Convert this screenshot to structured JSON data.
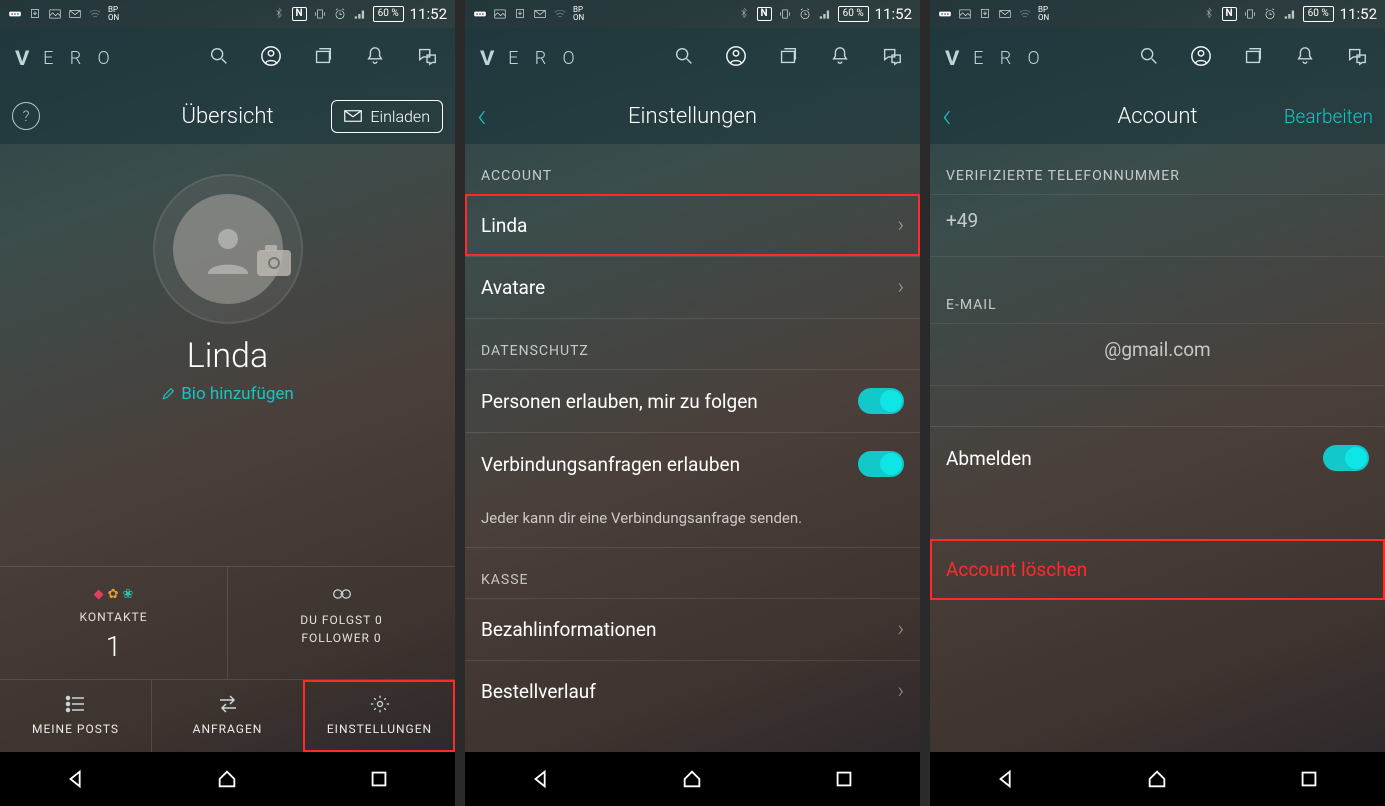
{
  "statusbar": {
    "battery": "60 %",
    "time": "11:52",
    "nfc": "N",
    "bp_top": "BP",
    "bp_bot": "ON"
  },
  "brand": "E R O",
  "screen1": {
    "title": "Übersicht",
    "invite": "Einladen",
    "username": "Linda",
    "bio": "Bio hinzufügen",
    "kontakte_label": "KONTAKTE",
    "kontakte_num": "1",
    "follow1": "DU FOLGST 0",
    "follow2": "FOLLOWER 0",
    "posts": "MEINE POSTS",
    "anfragen": "ANFRAGEN",
    "einstellungen": "EINSTELLUNGEN"
  },
  "screen2": {
    "title": "Einstellungen",
    "sec_account": "ACCOUNT",
    "row_name": "Linda",
    "row_avatar": "Avatare",
    "sec_privacy": "DATENSCHUTZ",
    "row_follow": "Personen erlauben, mir zu folgen",
    "row_conn": "Verbindungsanfragen erlauben",
    "hint": "Jeder kann dir eine Verbindungsanfrage senden.",
    "sec_kasse": "KASSE",
    "row_pay": "Bezahlinformationen",
    "row_hist": "Bestellverlauf"
  },
  "screen3": {
    "title": "Account",
    "edit": "Bearbeiten",
    "sec_phone": "VERIFIZIERTE TELEFONNUMMER",
    "phone": "+49",
    "sec_email": "E-MAIL",
    "email": "@gmail.com",
    "row_logout": "Abmelden",
    "row_delete": "Account löschen"
  }
}
